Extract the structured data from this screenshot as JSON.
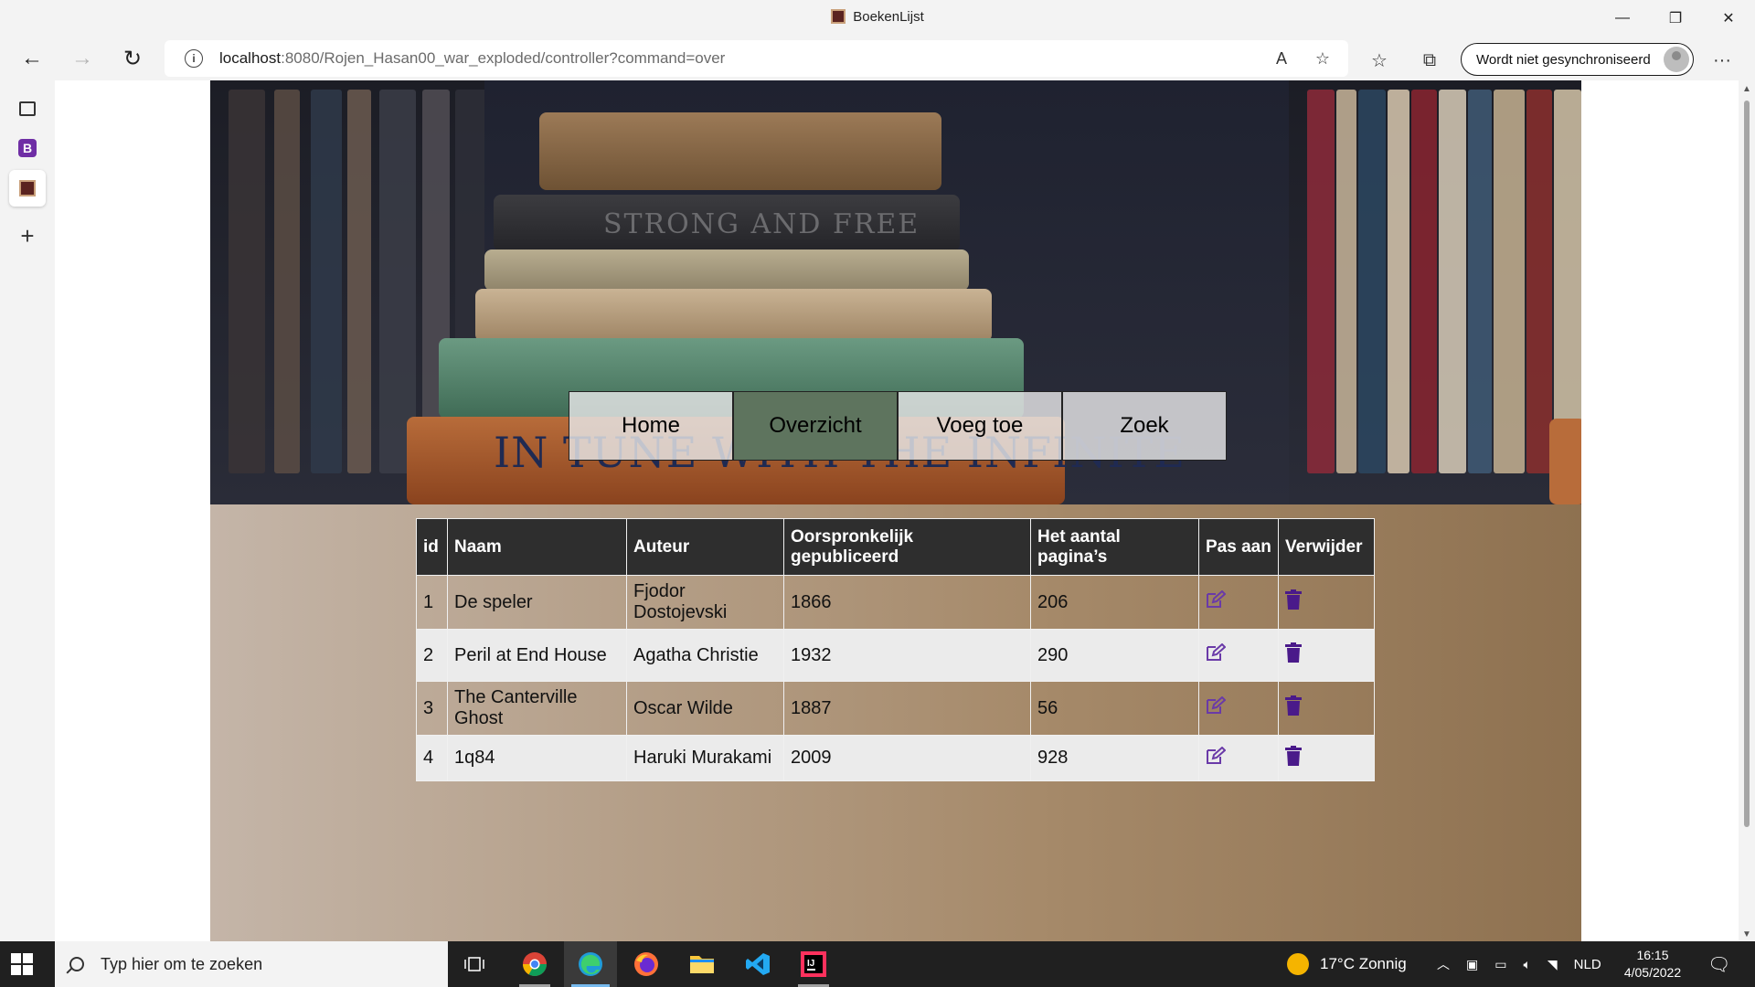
{
  "window": {
    "tab_title": "BoekenLijst",
    "minimize": "—",
    "restore": "❐",
    "close": "✕"
  },
  "toolbar": {
    "back": "←",
    "forward": "→",
    "refresh": "↻",
    "url_host": "localhost",
    "url_rest": ":8080/Rojen_Hasan00_war_exploded/controller?command=over",
    "read_aloud": "A",
    "add_favorite": "☆",
    "favorites": "☆",
    "collections": "⧉",
    "sync_label": "Wordt niet gesynchroniseerd",
    "more": "···"
  },
  "sidebar_tabs": {
    "new_tab": "+",
    "b_label": "B"
  },
  "hero": {
    "spine_text_1": "STRONG AND FREE",
    "spine_text_2": "IN TUNE WITH THE INFINITE"
  },
  "nav": {
    "items": [
      {
        "label": "Home"
      },
      {
        "label": "Overzicht"
      },
      {
        "label": "Voeg toe"
      },
      {
        "label": "Zoek"
      }
    ]
  },
  "table": {
    "headers": {
      "id": "id",
      "naam": "Naam",
      "auteur": "Auteur",
      "jaar": "Oorspronkelijk gepubliceerd",
      "paginas": "Het aantal pagina’s",
      "edit": "Pas aan",
      "delete": "Verwijder"
    },
    "rows": [
      {
        "id": "1",
        "naam": "De speler",
        "auteur": "Fjodor Dostojevski",
        "jaar": "1866",
        "paginas": "206"
      },
      {
        "id": "2",
        "naam": "Peril at End House",
        "auteur": "Agatha Christie",
        "jaar": "1932",
        "paginas": "290"
      },
      {
        "id": "3",
        "naam": "The Canterville Ghost",
        "auteur": "Oscar Wilde",
        "jaar": "1887",
        "paginas": "56"
      },
      {
        "id": "4",
        "naam": "1q84",
        "auteur": "Haruki Murakami",
        "jaar": "2009",
        "paginas": "928"
      }
    ]
  },
  "taskbar": {
    "search_placeholder": "Typ hier om te zoeken",
    "weather": "17°C Zonnig",
    "language": "NLD",
    "time": "16:15",
    "date": "4/05/2022"
  }
}
